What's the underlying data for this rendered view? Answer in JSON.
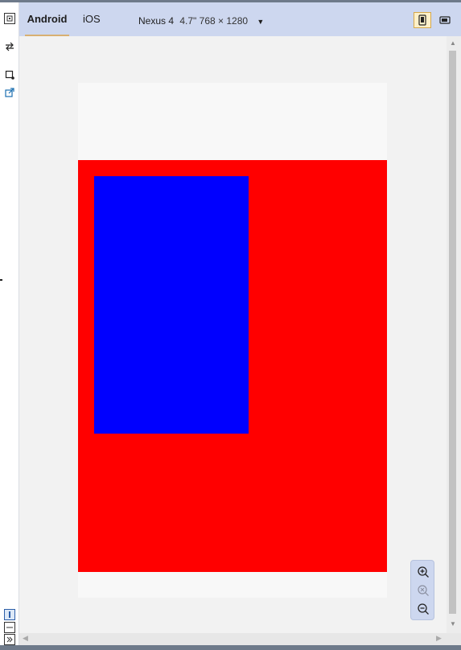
{
  "toolbar": {
    "tabs": [
      {
        "label": "Android",
        "active": true
      },
      {
        "label": "iOS",
        "active": false
      }
    ],
    "device": {
      "name": "Nexus 4",
      "spec": "4.7\" 768 × 1280"
    },
    "orientation": "portrait"
  },
  "left_rail": {
    "icons": [
      "emulation-toggle-icon",
      "swap-icon",
      "screenshot-icon",
      "popout-icon"
    ],
    "bottom_icons": [
      "dock-bottom-icon",
      "dock-minimize-icon",
      "expand-icon"
    ]
  },
  "viewport": {
    "colors": {
      "page_background": "#f8f8f8",
      "red_block": "#ff0000",
      "blue_block": "#0000ff"
    }
  },
  "zoom_controls": [
    "zoom-in-icon",
    "zoom-reset-icon",
    "zoom-out-icon"
  ],
  "colors": {
    "toolbar": "#cdd7ef",
    "accent_tab_underline": "#d8b072",
    "active_toggle": "#fdf0c8"
  }
}
